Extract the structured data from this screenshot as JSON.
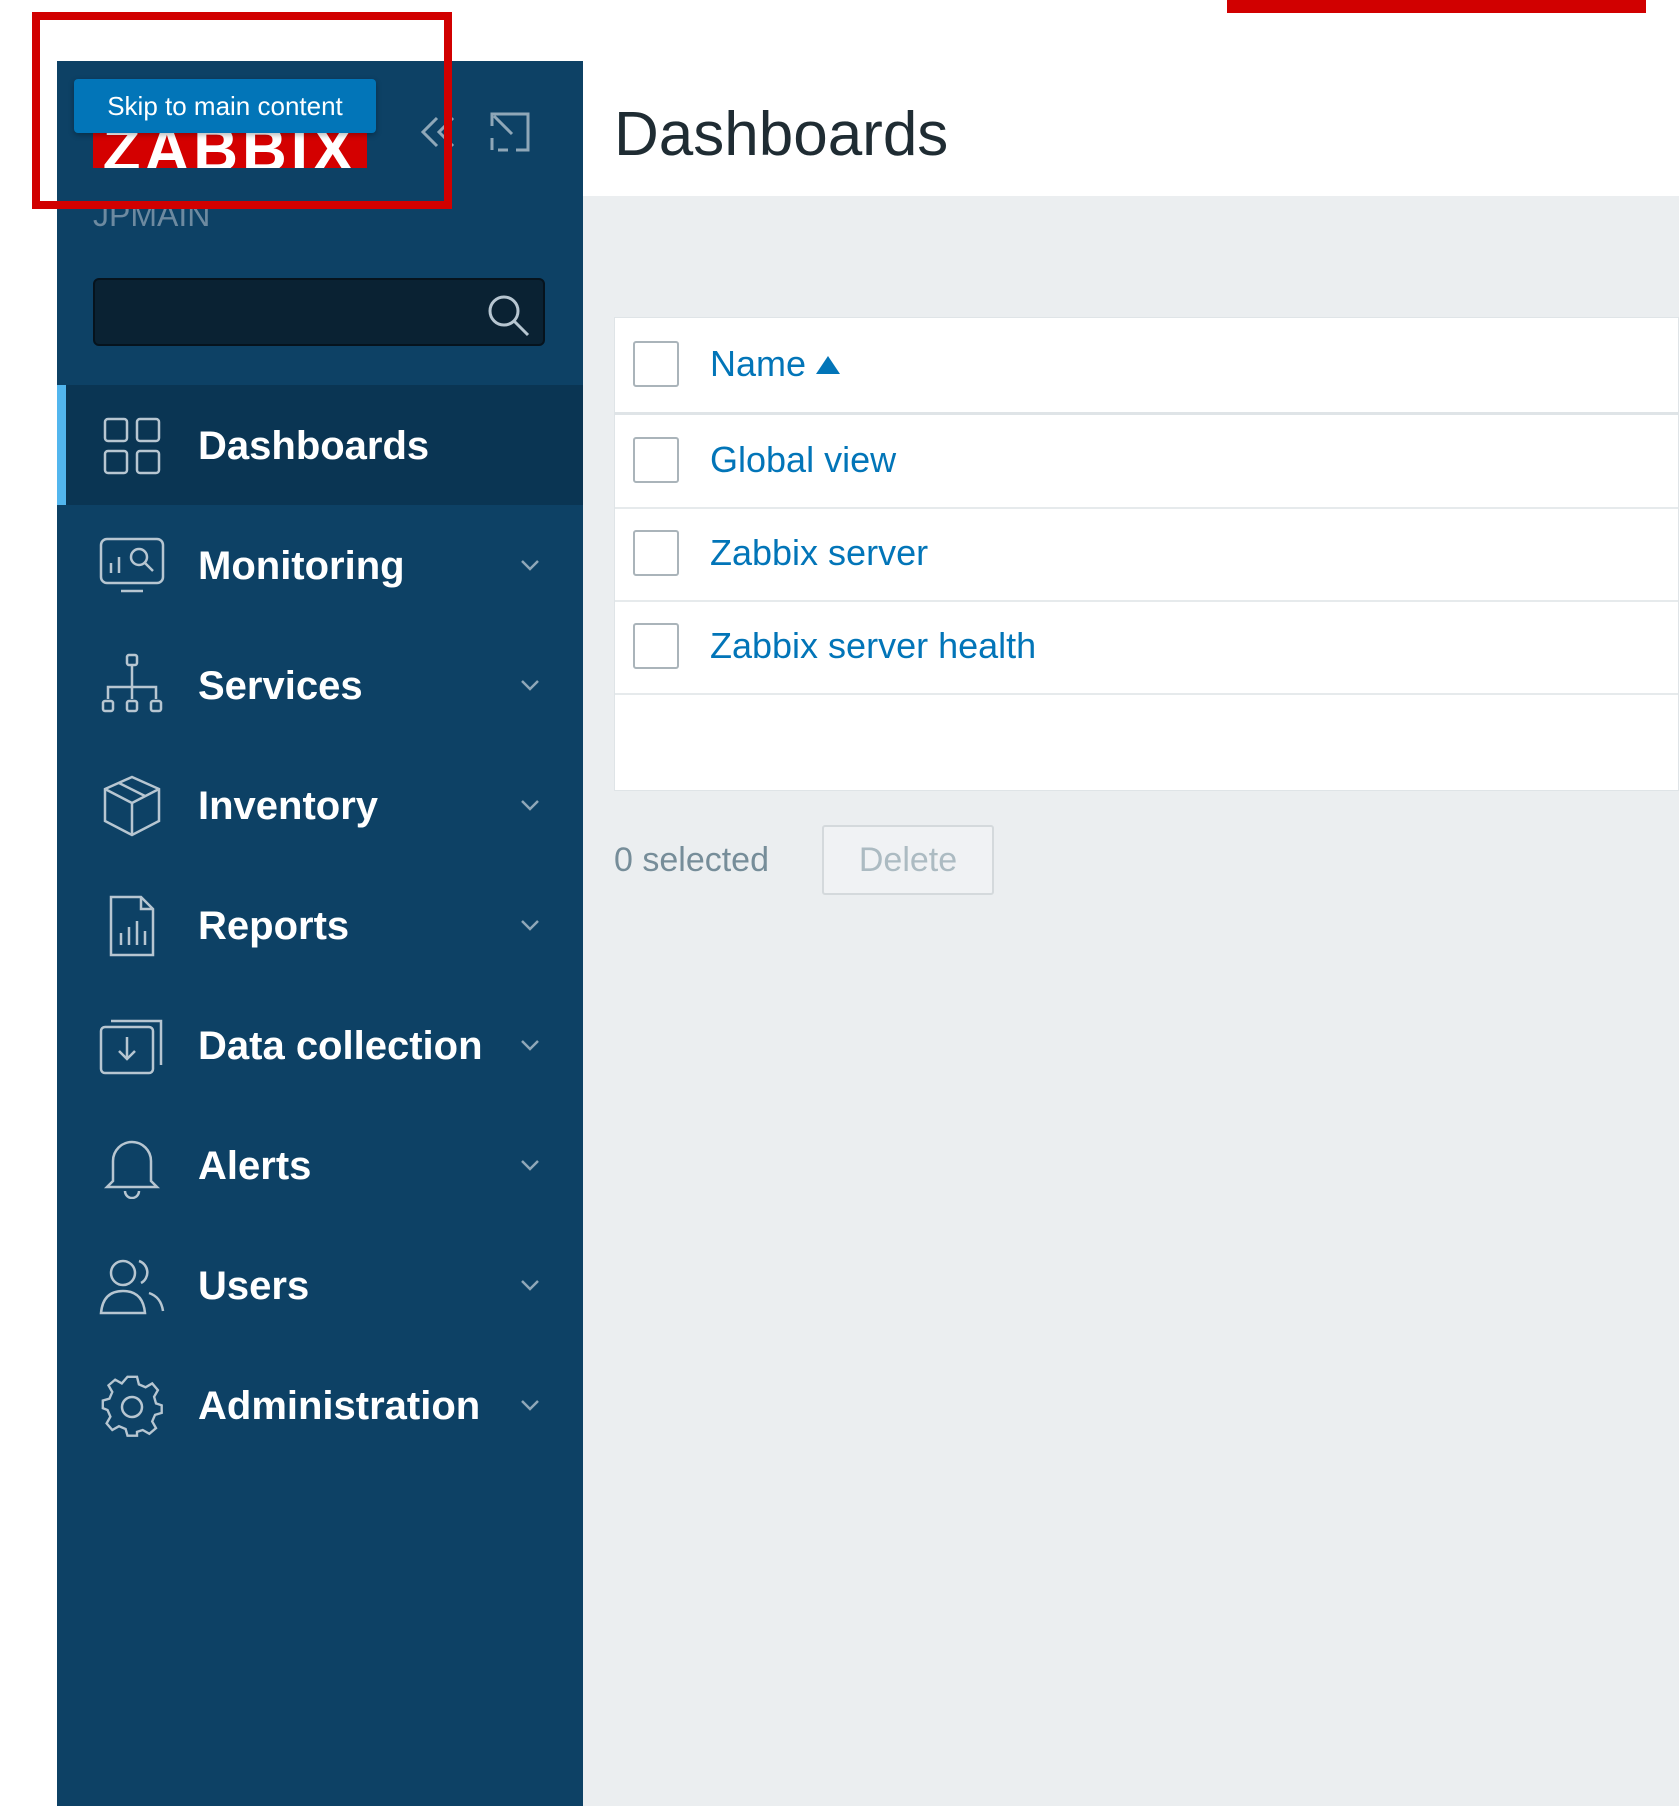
{
  "sidebar": {
    "logo": "ZABBIX",
    "skip_link": "Skip to main content",
    "server_name": "JPMAIN",
    "search": {
      "value": "",
      "placeholder": ""
    },
    "items": [
      {
        "label": "Dashboards",
        "icon": "dashboards-icon",
        "active": true
      },
      {
        "label": "Monitoring",
        "icon": "monitoring-icon"
      },
      {
        "label": "Services",
        "icon": "services-icon"
      },
      {
        "label": "Inventory",
        "icon": "inventory-icon"
      },
      {
        "label": "Reports",
        "icon": "reports-icon"
      },
      {
        "label": "Data collection",
        "icon": "data-collection-icon"
      },
      {
        "label": "Alerts",
        "icon": "alerts-icon"
      },
      {
        "label": "Users",
        "icon": "users-icon"
      },
      {
        "label": "Administration",
        "icon": "administration-icon"
      }
    ]
  },
  "header": {
    "title": "Dashboards"
  },
  "table": {
    "columns": [
      {
        "label": "Name",
        "sort": "ascending"
      }
    ],
    "rows": [
      {
        "name": "Global view"
      },
      {
        "name": "Zabbix server"
      },
      {
        "name": "Zabbix server health"
      }
    ]
  },
  "footer": {
    "selected_count": "0 selected",
    "delete_label": "Delete"
  },
  "colors": {
    "sidebar": "#0d4165",
    "logo": "#d40000",
    "link": "#0275b8",
    "active_indicator": "#52b6ee",
    "annotation": "#d10000"
  }
}
